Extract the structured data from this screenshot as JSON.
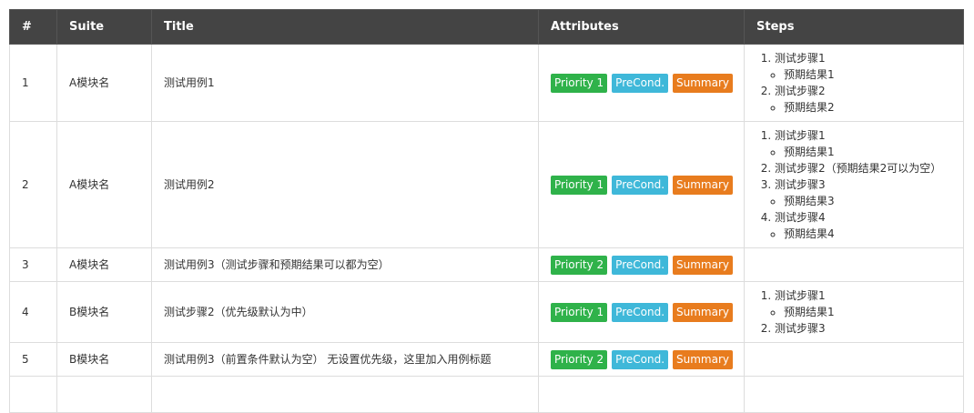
{
  "headers": [
    "#",
    "Suite",
    "Title",
    "Attributes",
    "Steps"
  ],
  "badge_labels": {
    "precond": "PreCond.",
    "summary": "Summary"
  },
  "badge_colors": {
    "priority": "#2fb24a",
    "precond": "#3fb8d9",
    "summary": "#e87c1e"
  },
  "rows": [
    {
      "num": "1",
      "suite": "A模块名",
      "title": "测试用例1",
      "priority": "Priority 1",
      "steps": [
        {
          "text": "测试步骤1",
          "results": [
            "预期结果1"
          ]
        },
        {
          "text": "测试步骤2",
          "results": [
            "预期结果2"
          ]
        }
      ]
    },
    {
      "num": "2",
      "suite": "A模块名",
      "title": "测试用例2",
      "priority": "Priority 1",
      "steps": [
        {
          "text": "测试步骤1",
          "results": [
            "预期结果1"
          ]
        },
        {
          "text": "测试步骤2（预期结果2可以为空）",
          "results": []
        },
        {
          "text": "测试步骤3",
          "results": [
            "预期结果3"
          ]
        },
        {
          "text": "测试步骤4",
          "results": [
            "预期结果4"
          ]
        }
      ]
    },
    {
      "num": "3",
      "suite": "A模块名",
      "title": "测试用例3（测试步骤和预期结果可以都为空）",
      "priority": "Priority 2",
      "steps": []
    },
    {
      "num": "4",
      "suite": "B模块名",
      "title": "测试步骤2（优先级默认为中）",
      "priority": "Priority 1",
      "steps": [
        {
          "text": "测试步骤1",
          "results": [
            "预期结果1"
          ]
        },
        {
          "text": "测试步骤3",
          "results": []
        }
      ]
    },
    {
      "num": "5",
      "suite": "B模块名",
      "title": "测试用例3（前置条件默认为空） 无设置优先级，这里加入用例标题",
      "priority": "Priority 2",
      "steps": []
    }
  ]
}
